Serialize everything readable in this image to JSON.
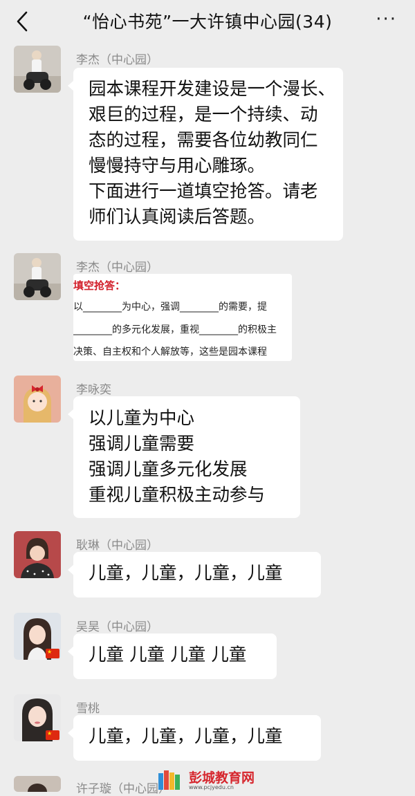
{
  "header": {
    "title": "“怡心书苑”一大许镇中心园(34)",
    "more_label": "···"
  },
  "messages": [
    {
      "sender": "李杰（中心园）",
      "lines": [
        "园本课程开发建设是一个漫长、",
        "艰巨的过程，是一个持续、动",
        "态的过程，需要各位幼教同仁",
        "慢慢持守与用心雕琢。",
        "下面进行一道填空抢答。请老",
        "师们认真阅读后答题。"
      ]
    },
    {
      "sender": "李杰（中心园）",
      "image": {
        "title": "填空抢答：",
        "lines": [
          "以________为中心，强调________的需要，提",
          "________的多元化发展，重视________的积极主",
          "决策、自主权和个人解放等，这些是园本课程"
        ]
      }
    },
    {
      "sender": "李咏奕",
      "lines": [
        "以儿童为中心",
        "强调儿童需要",
        "强调儿童多元化发展",
        "重视儿童积极主动参与"
      ]
    },
    {
      "sender": "耿琳（中心园）",
      "lines": [
        "儿童，儿童，儿童，儿童"
      ]
    },
    {
      "sender": "吴昊（中心园）",
      "lines": [
        "儿童 儿童 儿童 儿童"
      ]
    },
    {
      "sender": "雪桃",
      "lines": [
        "儿童，儿童，儿童，儿童"
      ]
    },
    {
      "sender": "许子璇（中心园）"
    }
  ],
  "watermark": {
    "name": "彭城教育网",
    "url": "www.pcjyedu.cn"
  },
  "colors": {
    "background": "#ededed",
    "bubble": "#ffffff",
    "sender_text": "#8a8a8a",
    "watermark_red": "#d6262d"
  }
}
